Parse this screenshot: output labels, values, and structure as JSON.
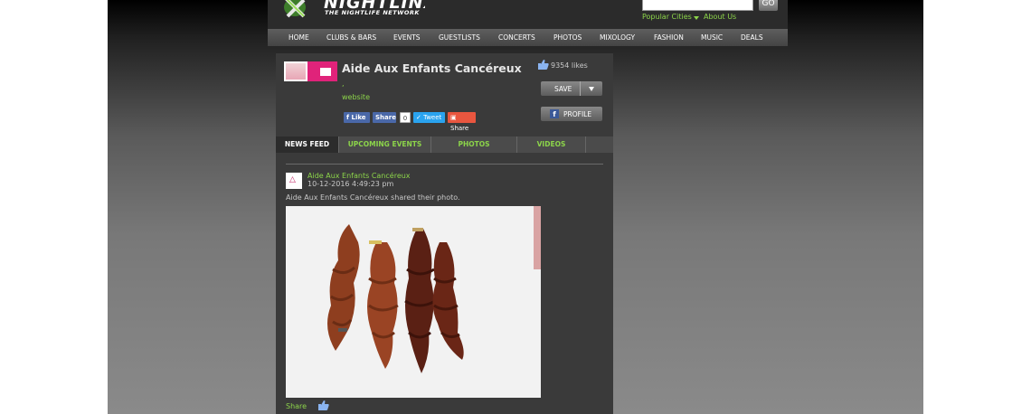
{
  "header": {
    "brand": "NIGHTLINX",
    "tagline": "THE NIGHTLIFE NETWORK",
    "search": {
      "value": "",
      "placeholder": ""
    },
    "go_label": "GO",
    "popular_cities_label": "Popular Cities",
    "about_us_label": "About Us"
  },
  "nav": {
    "items": [
      "HOME",
      "CLUBS & BARS",
      "EVENTS",
      "GUESTLISTS",
      "CONCERTS",
      "PHOTOS",
      "MIXOLOGY",
      "FASHION",
      "MUSIC",
      "DEALS"
    ]
  },
  "profile": {
    "name": "Aide Aux Enfants Cancéreux",
    "comma": ",",
    "website_label": "website",
    "likes": "9354 likes",
    "save_label": "SAVE",
    "profile_label": "PROFILE",
    "social": {
      "like_label": "Like",
      "share_label": "Share",
      "share_count": "0",
      "tweet_label": "Tweet",
      "google_share_label": "Share"
    }
  },
  "tabs": [
    "NEWS FEED",
    "UPCOMING EVENTS",
    "PHOTOS",
    "VIDEOS"
  ],
  "post": {
    "author": "Aide Aux Enfants Cancéreux",
    "timestamp": "10-12-2016 4:49:23 pm",
    "text": "Aide Aux Enfants Cancéreux shared their photo.",
    "share_label": "Share"
  },
  "colors": {
    "accent_green": "#8cd44a",
    "header_bg": "#2b2b2b",
    "content_bg": "#3a3a3a"
  }
}
